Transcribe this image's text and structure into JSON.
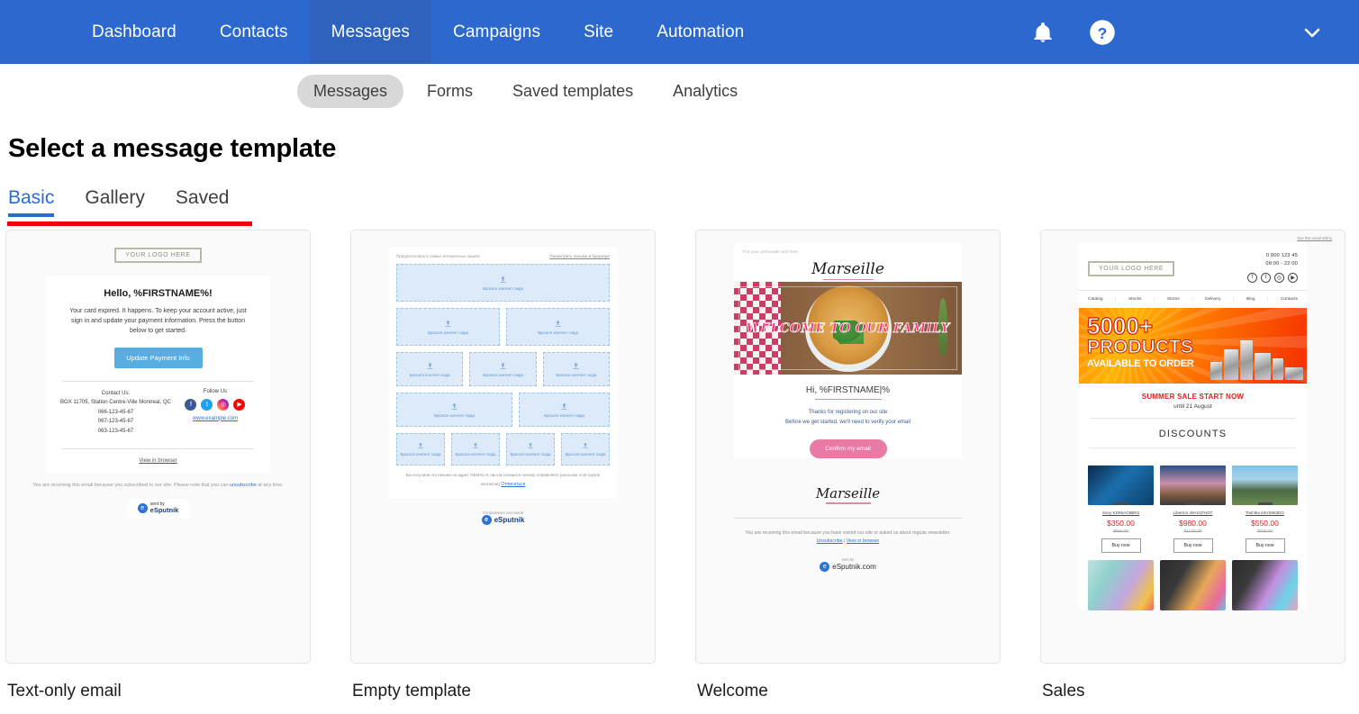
{
  "topnav": {
    "items": [
      {
        "label": "Dashboard",
        "active": false
      },
      {
        "label": "Contacts",
        "active": false
      },
      {
        "label": "Messages",
        "active": true
      },
      {
        "label": "Campaigns",
        "active": false
      },
      {
        "label": "Site",
        "active": false
      },
      {
        "label": "Automation",
        "active": false
      }
    ],
    "icons": {
      "bell": "bell-icon",
      "help": "help-icon",
      "chevron": "chevron-down-icon"
    },
    "brand_color": "#2c68ce",
    "active_color": "#2f62bd"
  },
  "subnav": {
    "items": [
      {
        "label": "Messages",
        "active": true
      },
      {
        "label": "Forms",
        "active": false
      },
      {
        "label": "Saved templates",
        "active": false
      },
      {
        "label": "Analytics",
        "active": false
      }
    ]
  },
  "page": {
    "title": "Select a message template",
    "accent_color": "#2b6bd4",
    "annotation_color": "#f20000"
  },
  "category_tabs": [
    {
      "label": "Basic",
      "active": true
    },
    {
      "label": "Gallery",
      "active": false
    },
    {
      "label": "Saved",
      "active": false
    }
  ],
  "templates": [
    {
      "name": "Text-only email",
      "preview": {
        "logo": "YOUR LOGO HERE",
        "heading": "Hello, %FIRSTNAME%!",
        "body": "Your card expired. It happens. To keep your account active, just sign in and update your payment information. Press the button below to get started.",
        "button": "Update Payment Info",
        "contact_title": "Contact Us:",
        "address": "BOX 11705, Station Centre-Ville Montreal, QC",
        "phones": [
          "066-123-45-67",
          "067-123-45-67",
          "063-123-45-67"
        ],
        "follow_title": "Follow Us",
        "socials": [
          "facebook-icon",
          "twitter-icon",
          "instagram-icon",
          "youtube-icon"
        ],
        "website": "www.example.com",
        "view_in_browser": "View in browser",
        "footer_pre": "You are receiving this email because you subscribed to our site. Please note that you can ",
        "footer_link": "unsubscribe",
        "footer_post": " at any time.",
        "sent_by": "sent by",
        "brand": "eSputnik"
      }
    },
    {
      "name": "Empty template",
      "preview": {
        "preheader": "Предзаголовок в самых интересных акциях",
        "view_link": "Посмотреть письмо в браузере",
        "drop_label": "Бросьте контент сюда",
        "drop_label_short": "Бросьте контент сюда",
        "footer": "Вы получили это письмо на адрес %EMAIL% так как (опишите почему отправляете рассылки этой группе контактов)",
        "unsubscribe": "Отписаться",
        "sent_by": "Отправлено системой",
        "brand": "eSputnik"
      }
    },
    {
      "name": "Welcome",
      "preview": {
        "preheader": "Put your preheader text here",
        "brand": "Marseille",
        "hero_text": "WELCOME TO OUR FAMILY",
        "greeting": "Hi, %FIRSTNAME|%",
        "sub_line1": "Thanks for registering on our site",
        "sub_line2": "Before we get started, we'll need to verify your email",
        "button": "Confirm my email",
        "footer": "You are receiving this email because you have visited our site or asked us about regular newsletter.",
        "unsubscribe": "Unsubscribe",
        "view_in_browser": "View in browser",
        "sent_by": "sent by",
        "brand_footer": "eSputnik.com"
      }
    },
    {
      "name": "Sales",
      "preview": {
        "top_link": "See this email online",
        "logo": "YOUR LOGO HERE",
        "phone": "0 800 123 45",
        "hours": "08:00 - 22:00",
        "socials": [
          "facebook-icon",
          "twitter-icon",
          "instagram-icon",
          "youtube-icon"
        ],
        "nav": [
          "Catalog",
          "Stocks",
          "Stores",
          "Delivery",
          "Blog",
          "Contacts"
        ],
        "banner_line1": "5000+",
        "banner_line2": "PRODUCTS",
        "banner_line3": "AVAILABLE TO ORDER",
        "sale_title": "SUMMER SALE START NOW",
        "sale_sub": "until 21 August",
        "section_title": "DISCOUNTS",
        "products": [
          {
            "name": "Sony KD55AG8BR2",
            "price": "$350.00",
            "old_price": "$560.00",
            "buy": "Buy now"
          },
          {
            "name": "Liberton 49AS1FHDT",
            "price": "$980.00",
            "old_price": "$1120.00",
            "buy": "Buy now"
          },
          {
            "name": "Toshiba 53VS863DG",
            "price": "$550.00",
            "old_price": "$700.00",
            "buy": "Buy now"
          }
        ]
      }
    }
  ]
}
